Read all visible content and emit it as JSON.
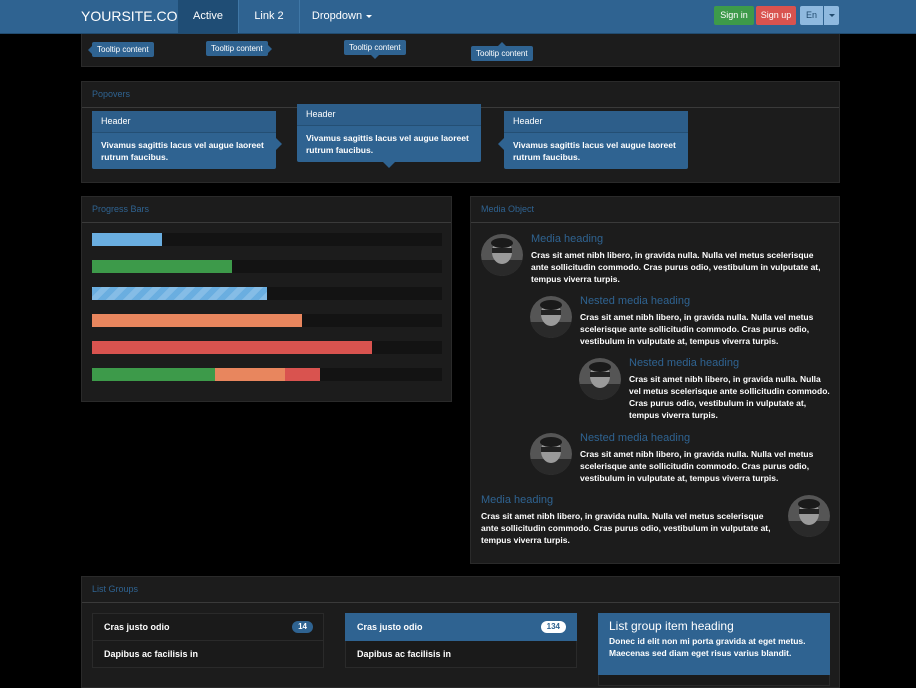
{
  "navbar": {
    "brand": "YOURSITE.COM",
    "items": [
      {
        "label": "Active"
      },
      {
        "label": "Link 2"
      },
      {
        "label": "Dropdown"
      }
    ],
    "signin_label": "Sign in",
    "signup_label": "Sign up",
    "lang_label": "En"
  },
  "tooltips": {
    "items": [
      {
        "label": "Tooltip content"
      },
      {
        "label": "Tooltip content"
      },
      {
        "label": "Tooltip content"
      },
      {
        "label": "Tooltip content"
      }
    ]
  },
  "popovers": {
    "title": "Popovers",
    "items": [
      {
        "header": "Header",
        "content": "Vivamus sagittis lacus vel augue laoreet rutrum faucibus."
      },
      {
        "header": "Header",
        "content": "Vivamus sagittis lacus vel augue laoreet rutrum faucibus."
      },
      {
        "header": "Header",
        "content": "Vivamus sagittis lacus vel augue laoreet rutrum faucibus."
      }
    ]
  },
  "progress": {
    "title": "Progress Bars",
    "bars": [
      {
        "value": 20,
        "color": "#6aaee0"
      },
      {
        "value": 40,
        "color": "#3d9a4a"
      },
      {
        "value": 50,
        "color": "#6aaee0",
        "striped": true
      },
      {
        "value": 60,
        "color": "#e8865e"
      },
      {
        "value": 80,
        "color": "#d9534f"
      },
      {
        "stacked": [
          {
            "value": 35,
            "color": "#3d9a4a"
          },
          {
            "value": 20,
            "color": "#e8865e"
          },
          {
            "value": 10,
            "color": "#d9534f"
          }
        ]
      }
    ]
  },
  "media": {
    "title": "Media Object",
    "items": [
      {
        "heading": "Media heading",
        "body": "Cras sit amet nibh libero, in gravida nulla. Nulla vel metus scelerisque ante sollicitudin commodo. Cras purus odio, vestibulum in vulputate at, tempus viverra turpis."
      },
      {
        "heading": "Nested media heading",
        "body": "Cras sit amet nibh libero, in gravida nulla. Nulla vel metus scelerisque ante sollicitudin commodo. Cras purus odio, vestibulum in vulputate at, tempus viverra turpis."
      },
      {
        "heading": "Nested media heading",
        "body": "Cras sit amet nibh libero, in gravida nulla. Nulla vel metus scelerisque ante sollicitudin commodo. Cras purus odio, vestibulum in vulputate at, tempus viverra turpis."
      },
      {
        "heading": "Nested media heading",
        "body": "Cras sit amet nibh libero, in gravida nulla. Nulla vel metus scelerisque ante sollicitudin commodo. Cras purus odio, vestibulum in vulputate at, tempus viverra turpis."
      },
      {
        "heading": "Media heading",
        "body": "Cras sit amet nibh libero, in gravida nulla. Nulla vel metus scelerisque ante sollicitudin commodo. Cras purus odio, vestibulum in vulputate at, tempus viverra turpis."
      }
    ]
  },
  "list_groups": {
    "title": "List Groups",
    "group1": [
      {
        "label": "Cras justo odio",
        "badge": "14"
      },
      {
        "label": "Dapibus ac facilisis in"
      }
    ],
    "group2": [
      {
        "label": "Cras justo odio",
        "badge": "134"
      },
      {
        "label": "Dapibus ac facilisis in"
      }
    ],
    "group3": {
      "heading": "List group item heading",
      "text": "Donec id elit non mi porta gravida at eget metus. Maecenas sed diam eget risus varius blandit."
    }
  },
  "colors": {
    "primary": "#2f6391",
    "success": "#3d9a4a",
    "danger": "#d9534f",
    "warning": "#e8865e",
    "info": "#6aaee0"
  }
}
